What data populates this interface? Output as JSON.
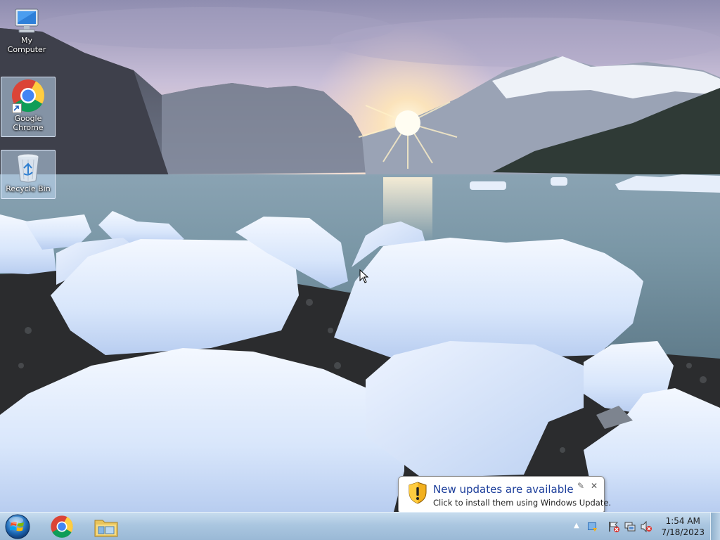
{
  "desktop": {
    "icons": [
      {
        "label": "My Computer",
        "icon": "computer-icon"
      },
      {
        "label": "Google Chrome",
        "label_line1": "Google",
        "label_line2": "Chrome",
        "icon": "chrome-icon"
      },
      {
        "label": "Recycle Bin",
        "icon": "recycle-bin-icon"
      }
    ]
  },
  "taskbar": {
    "pinned": [
      {
        "name": "start-button",
        "icon": "windows-orb-icon"
      },
      {
        "name": "chrome-taskbar-button",
        "icon": "chrome-icon"
      },
      {
        "name": "explorer-taskbar-button",
        "icon": "folder-icon"
      }
    ],
    "tray_icons": [
      "show-hidden-icons-arrow",
      "windows-update-icon",
      "action-center-flag-icon",
      "network-icon",
      "volume-muted-icon"
    ],
    "clock": {
      "time": "1:54 AM",
      "date": "7/18/2023"
    }
  },
  "notification": {
    "title": "New updates are available",
    "message": "Click to install them using Windows Update.",
    "icon": "shield-warning-icon"
  },
  "colors": {
    "balloon_title": "#1b3d9a",
    "taskbar": "#aac6e0"
  }
}
